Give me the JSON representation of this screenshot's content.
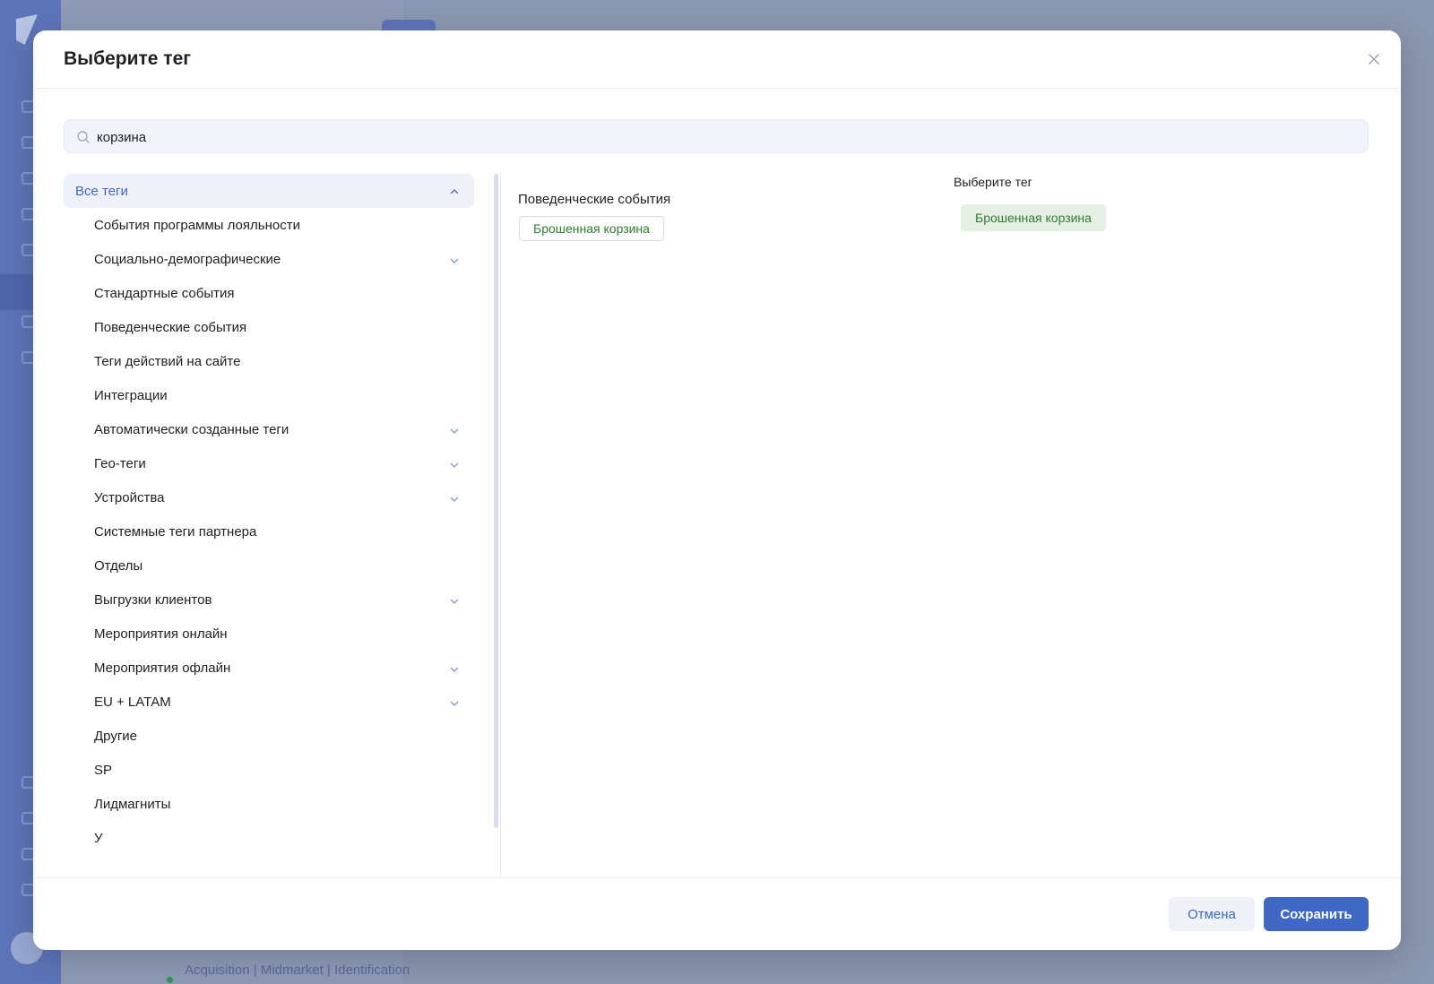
{
  "background": {
    "list_row_text": "Acquisition | Midmarket | Identification"
  },
  "modal": {
    "title": "Выберите тег",
    "close_icon": "close-icon"
  },
  "search": {
    "value": "корзина",
    "icon": "search-icon"
  },
  "tree": {
    "root": {
      "label": "Все теги",
      "expanded": true
    },
    "items": [
      {
        "label": "События программы лояльности",
        "has_children": false
      },
      {
        "label": "Социально-демографические",
        "has_children": true
      },
      {
        "label": "Стандартные события",
        "has_children": false
      },
      {
        "label": "Поведенческие события",
        "has_children": false
      },
      {
        "label": "Теги действий на сайте",
        "has_children": false
      },
      {
        "label": "Интеграции",
        "has_children": false
      },
      {
        "label": "Автоматически созданные теги",
        "has_children": true
      },
      {
        "label": "Гео-теги",
        "has_children": true
      },
      {
        "label": "Устройства",
        "has_children": true
      },
      {
        "label": "Системные теги партнера",
        "has_children": false
      },
      {
        "label": "Отделы",
        "has_children": false
      },
      {
        "label": "Выгрузки клиентов",
        "has_children": true
      },
      {
        "label": "Мероприятия онлайн",
        "has_children": false
      },
      {
        "label": "Мероприятия офлайн",
        "has_children": true
      },
      {
        "label": "EU + LATAM",
        "has_children": true
      },
      {
        "label": "Другие",
        "has_children": false
      },
      {
        "label": "SP",
        "has_children": false
      },
      {
        "label": "Лидмагниты",
        "has_children": false
      },
      {
        "label": "У",
        "has_children": false
      }
    ]
  },
  "results": {
    "group_title": "Поведенческие события",
    "tags": [
      "Брошенная корзина"
    ]
  },
  "selected": {
    "title": "Выберите тег",
    "tags": [
      "Брошенная корзина"
    ]
  },
  "footer": {
    "cancel_label": "Отмена",
    "save_label": "Сохранить"
  },
  "colors": {
    "accent": "#3f68c5",
    "tag_text": "#2e7d32",
    "selected_tag_bg": "#e6efe3"
  }
}
